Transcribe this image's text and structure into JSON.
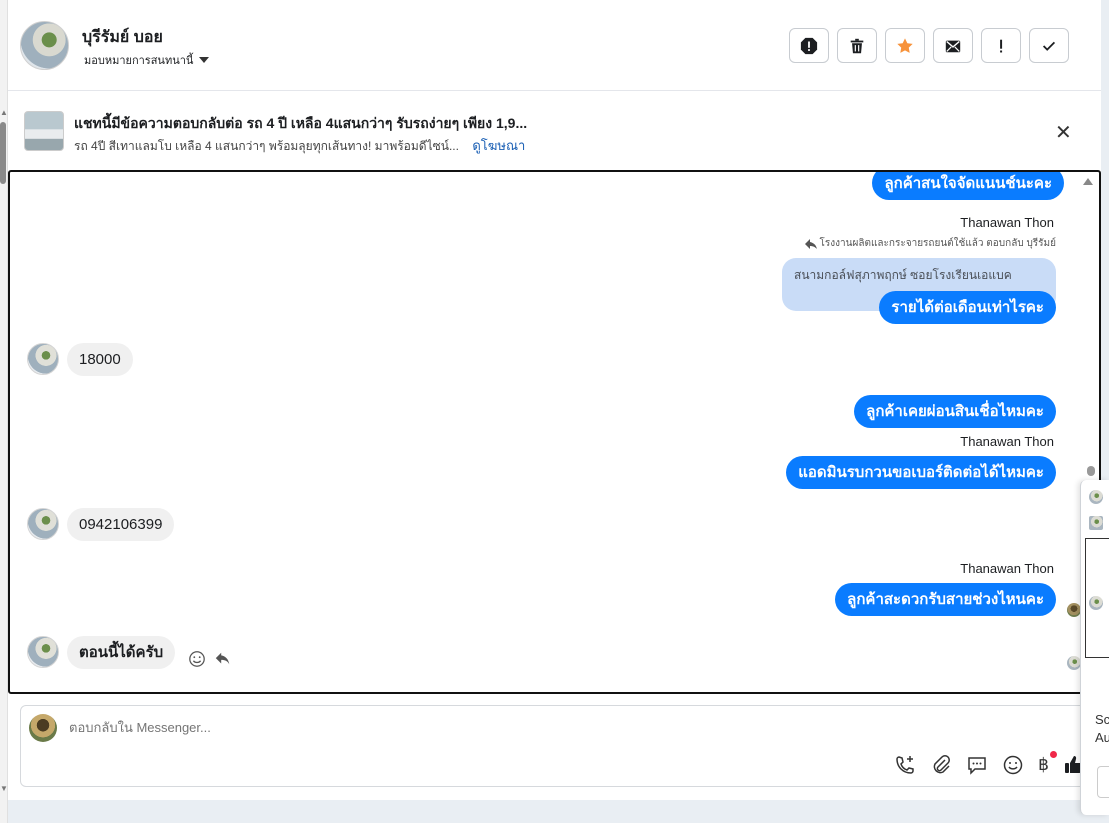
{
  "header": {
    "contact_name": "บุรีรัมย์ บอย",
    "assign_label": "มอบหมายการสนทนานี้",
    "toolbar": [
      {
        "name": "report-spam-button",
        "icon": "alert-octagon-icon"
      },
      {
        "name": "delete-button",
        "icon": "trash-icon"
      },
      {
        "name": "star-button",
        "icon": "star-icon"
      },
      {
        "name": "mark-unread-button",
        "icon": "envelope-icon"
      },
      {
        "name": "follow-up-button",
        "icon": "exclamation-icon"
      },
      {
        "name": "mark-done-button",
        "icon": "check-icon"
      }
    ]
  },
  "ad": {
    "title": "แชทนี้มีข้อความตอบกลับต่อ รถ 4 ปี เหลือ 4แสนกว่าๆ รับรถง่ายๆ เพียง 1,9...",
    "subtitle": "รถ 4ปี สีเทาแลมโบ เหลือ 4 แสนกว่าๆ พร้อมลุยทุกเส้นทาง! มาพร้อมดีไซน์...",
    "link": "ดูโฆษณา",
    "close": "✕"
  },
  "messages": {
    "m1": "ลูกค้าสนใจจัดแนนช์นะคะ",
    "sender1": "Thanawan Thon",
    "reply_note": "โรงงานผลิตและกระจายรถยนต์ใช้แล้ว ตอบกลับ บุรีรัมย์",
    "quoted": "สนามกอล์ฟสุภาพฤกษ์ ซอยโรงเรียนเอแบค",
    "m2": "รายได้ต่อเดือนเท่าไรคะ",
    "in1": "18000",
    "m3": "ลูกค้าเคยผ่อนสินเชื่อไหมคะ",
    "sender2": "Thanawan Thon",
    "m4": "แอดมินรบกวนขอเบอร์ติดต่อได้ไหมคะ",
    "in2": "0942106399",
    "sender3": "Thanawan Thon",
    "m5": "ลูกค้าสะดวกรับสายช่วงไหนคะ",
    "in3": "ตอนนี้ได้ครับ"
  },
  "composer": {
    "placeholder": "ตอบกลับใน Messenger...",
    "baht_symbol": "฿"
  },
  "side_popup": {
    "line1": "Sc",
    "line2": "Au"
  }
}
